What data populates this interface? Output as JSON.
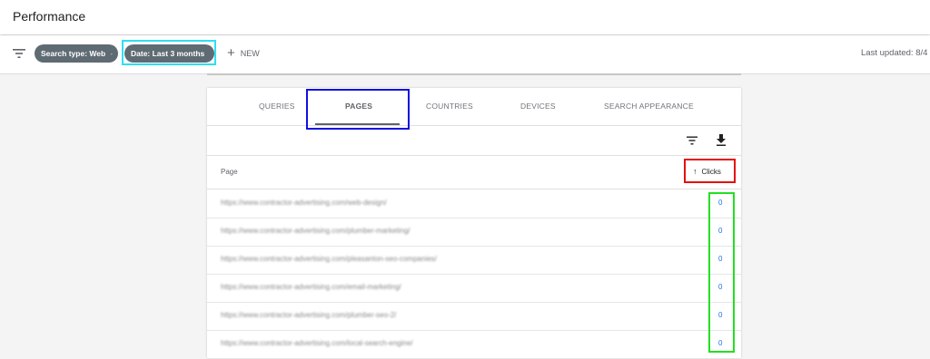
{
  "header": {
    "title": "Performance"
  },
  "filterbar": {
    "chips": [
      {
        "label": "Search type: Web"
      },
      {
        "label": "Date: Last 3 months"
      }
    ],
    "new_label": "NEW",
    "last_updated": "Last updated: 8/4"
  },
  "tabs": [
    {
      "label": "QUERIES",
      "active": false
    },
    {
      "label": "PAGES",
      "active": true
    },
    {
      "label": "COUNTRIES",
      "active": false
    },
    {
      "label": "DEVICES",
      "active": false
    },
    {
      "label": "SEARCH APPEARANCE",
      "active": false
    }
  ],
  "table": {
    "columns": {
      "page": "Page",
      "clicks": "Clicks"
    },
    "sort": {
      "column": "clicks",
      "direction": "ascending",
      "icon": "arrow-up-icon"
    },
    "rows": [
      {
        "url": "https://www.contractor-advertising.com/web-design/",
        "clicks": "0"
      },
      {
        "url": "https://www.contractor-advertising.com/plumber-marketing/",
        "clicks": "0"
      },
      {
        "url": "https://www.contractor-advertising.com/pleasanton-seo-companies/",
        "clicks": "0"
      },
      {
        "url": "https://www.contractor-advertising.com/email-marketing/",
        "clicks": "0"
      },
      {
        "url": "https://www.contractor-advertising.com/plumber-seo-2/",
        "clicks": "0"
      },
      {
        "url": "https://www.contractor-advertising.com/local-search-engine/",
        "clicks": "0"
      }
    ]
  },
  "colors": {
    "chip_bg": "#5f6b73",
    "link_blue": "#1a73e8",
    "annotation_cyan": "#2de0f0",
    "annotation_blue": "#1010e0",
    "annotation_red": "#e41010",
    "annotation_green": "#22e022"
  }
}
